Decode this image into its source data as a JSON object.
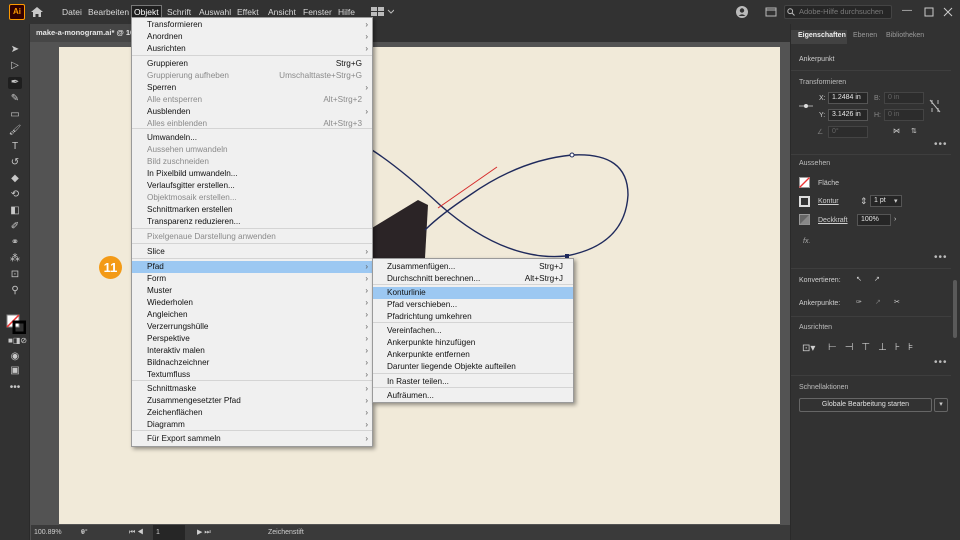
{
  "app": {
    "logo": "Ai"
  },
  "menubar": {
    "items": [
      "Datei",
      "Bearbeiten",
      "Objekt",
      "Schrift",
      "Auswahl",
      "Effekt",
      "Ansicht",
      "Fenster",
      "Hilfe"
    ],
    "search_placeholder": "Adobe-Hilfe durchsuchen"
  },
  "document": {
    "tab_title": "make-a-monogram.ai* @ 10"
  },
  "step_badge": "11",
  "objekt_menu": {
    "items": [
      {
        "label": "Transformieren",
        "shortcut": "",
        "submenu": true,
        "disabled": false
      },
      {
        "label": "Anordnen",
        "shortcut": "",
        "submenu": true,
        "disabled": false
      },
      {
        "label": "Ausrichten",
        "shortcut": "",
        "submenu": true,
        "disabled": false
      },
      {
        "label": "Gruppieren",
        "shortcut": "Strg+G",
        "submenu": false,
        "disabled": false
      },
      {
        "label": "Gruppierung aufheben",
        "shortcut": "Umschalttaste+Strg+G",
        "submenu": false,
        "disabled": true
      },
      {
        "label": "Sperren",
        "shortcut": "",
        "submenu": true,
        "disabled": false
      },
      {
        "label": "Alle entsperren",
        "shortcut": "Alt+Strg+2",
        "submenu": false,
        "disabled": true
      },
      {
        "label": "Ausblenden",
        "shortcut": "",
        "submenu": true,
        "disabled": false
      },
      {
        "label": "Alles einblenden",
        "shortcut": "Alt+Strg+3",
        "submenu": false,
        "disabled": true
      },
      {
        "label": "Umwandeln...",
        "shortcut": "",
        "submenu": false,
        "disabled": false
      },
      {
        "label": "Aussehen umwandeln",
        "shortcut": "",
        "submenu": false,
        "disabled": true
      },
      {
        "label": "Bild zuschneiden",
        "shortcut": "",
        "submenu": false,
        "disabled": true
      },
      {
        "label": "In Pixelbild umwandeln...",
        "shortcut": "",
        "submenu": false,
        "disabled": false
      },
      {
        "label": "Verlaufsgitter erstellen...",
        "shortcut": "",
        "submenu": false,
        "disabled": false
      },
      {
        "label": "Objektmosaik erstellen...",
        "shortcut": "",
        "submenu": false,
        "disabled": true
      },
      {
        "label": "Schnittmarken erstellen",
        "shortcut": "",
        "submenu": false,
        "disabled": false
      },
      {
        "label": "Transparenz reduzieren...",
        "shortcut": "",
        "submenu": false,
        "disabled": false
      },
      {
        "label": "Pixelgenaue Darstellung anwenden",
        "shortcut": "",
        "submenu": false,
        "disabled": true
      },
      {
        "label": "Slice",
        "shortcut": "",
        "submenu": true,
        "disabled": false
      },
      {
        "label": "Pfad",
        "shortcut": "",
        "submenu": true,
        "disabled": false,
        "highlight": true
      },
      {
        "label": "Form",
        "shortcut": "",
        "submenu": true,
        "disabled": false
      },
      {
        "label": "Muster",
        "shortcut": "",
        "submenu": true,
        "disabled": false
      },
      {
        "label": "Wiederholen",
        "shortcut": "",
        "submenu": true,
        "disabled": false
      },
      {
        "label": "Angleichen",
        "shortcut": "",
        "submenu": true,
        "disabled": false
      },
      {
        "label": "Verzerrungshülle",
        "shortcut": "",
        "submenu": true,
        "disabled": false
      },
      {
        "label": "Perspektive",
        "shortcut": "",
        "submenu": true,
        "disabled": false
      },
      {
        "label": "Interaktiv malen",
        "shortcut": "",
        "submenu": true,
        "disabled": false
      },
      {
        "label": "Bildnachzeichner",
        "shortcut": "",
        "submenu": true,
        "disabled": false
      },
      {
        "label": "Textumfluss",
        "shortcut": "",
        "submenu": true,
        "disabled": false
      },
      {
        "label": "Schnittmaske",
        "shortcut": "",
        "submenu": true,
        "disabled": false
      },
      {
        "label": "Zusammengesetzter Pfad",
        "shortcut": "",
        "submenu": true,
        "disabled": false
      },
      {
        "label": "Zeichenflächen",
        "shortcut": "",
        "submenu": true,
        "disabled": false
      },
      {
        "label": "Diagramm",
        "shortcut": "",
        "submenu": true,
        "disabled": false
      },
      {
        "label": "Für Export sammeln",
        "shortcut": "",
        "submenu": true,
        "disabled": false
      }
    ]
  },
  "pfad_submenu": {
    "items": [
      {
        "label": "Zusammenfügen...",
        "shortcut": "Strg+J"
      },
      {
        "label": "Durchschnitt berechnen...",
        "shortcut": "Alt+Strg+J"
      },
      {
        "label": "Konturlinie",
        "shortcut": "",
        "highlight": true
      },
      {
        "label": "Pfad verschieben...",
        "shortcut": ""
      },
      {
        "label": "Pfadrichtung umkehren",
        "shortcut": ""
      },
      {
        "label": "Vereinfachen...",
        "shortcut": ""
      },
      {
        "label": "Ankerpunkte hinzufügen",
        "shortcut": ""
      },
      {
        "label": "Ankerpunkte entfernen",
        "shortcut": ""
      },
      {
        "label": "Darunter liegende Objekte aufteilen",
        "shortcut": ""
      },
      {
        "label": "In Raster teilen...",
        "shortcut": ""
      },
      {
        "label": "Aufräumen...",
        "shortcut": ""
      }
    ]
  },
  "panel": {
    "tabs": [
      "Eigenschaften",
      "Ebenen",
      "Bibliotheken"
    ],
    "selection_type": "Ankerpunkt",
    "transform": {
      "title": "Transformieren",
      "x_label": "X:",
      "x_value": "1.2484 in",
      "y_label": "Y:",
      "y_value": "3.1426 in",
      "b_label": "B:",
      "b_value": "0 in",
      "h_label": "H:",
      "h_value": "0 in",
      "angle": "0°"
    },
    "appearance": {
      "title": "Aussehen",
      "fill_label": "Fläche",
      "stroke_label": "Kontur",
      "stroke_weight": "1 pt",
      "opacity_label": "Deckkraft",
      "opacity_value": "100%",
      "fx": "fx."
    },
    "convert_label": "Konvertieren:",
    "anchors_label": "Ankerpunkte:",
    "align_title": "Ausrichten",
    "quick_actions_title": "Schnellaktionen",
    "quick_action_button": "Globale Bearbeitung starten"
  },
  "statusbar": {
    "zoom": "100.89%",
    "rotation": "0°",
    "artboard": "1",
    "tool": "Zeichenstift"
  },
  "colors": {
    "accent_highlight": "#9cc8f2",
    "badge": "#f39a16",
    "curve": "#1f2a5c",
    "guide": "#d62b2b"
  }
}
